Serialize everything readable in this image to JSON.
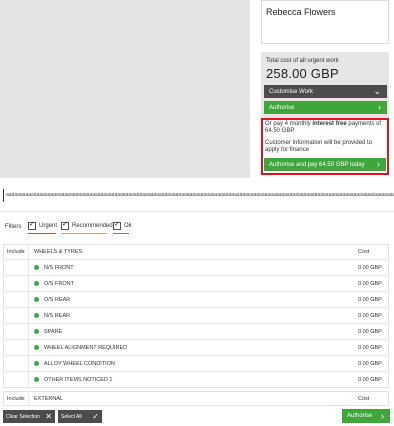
{
  "customer": {
    "name": "Rebecca Flowers"
  },
  "cost": {
    "label": "Total cost of all urgent work",
    "value": "258.00 GBP",
    "customise_label": "Customise Work",
    "authorise_label": "Authorise"
  },
  "finance": {
    "prefix": "Or pay 4 monthly ",
    "bold": "interest free",
    "suffix": " payments of 64.50 GBP",
    "info": "Customer information will be provided to apply for finance",
    "button_label": "Authorise and pay 64.50 GBP today"
  },
  "notes_value": "aaaaaaaaaaaaaaaaaaaaaaaaaaaaaaaaaaaaaaaaaaaaaaaaaaaaaaaaaaaaaaaaaaaaaaaaaaaaaaaaaaaaaaaaaaaaaaaaaaaaaaaaaaaaaaaaaaaaaaaaaaaaaaaaaaaaaaaaaaaaaaaaaaaaaaaaaaaaaaaaaaaaaaaaaaaaaaaaaaaaaaaa",
  "filters": {
    "label": "Filters",
    "urgent": "Urgent",
    "recommended": "Recommended",
    "ok": "Ok"
  },
  "table": {
    "include_header": "Include",
    "section": "WHEELS & TYRES",
    "cost_header": "Cost",
    "items": [
      {
        "name": "N/S FRONT",
        "cost": "0.00 GBP"
      },
      {
        "name": "O/S FRONT",
        "cost": "0.00 GBP"
      },
      {
        "name": "O/S REAR",
        "cost": "0.00 GBP"
      },
      {
        "name": "N/S REAR",
        "cost": "0.00 GBP"
      },
      {
        "name": "SPARE",
        "cost": "0.00 GBP"
      },
      {
        "name": "WHEEL ALIGNMENT REQUIRED",
        "cost": "0.00 GBP"
      },
      {
        "name": "ALLOY WHEEL CONDITION",
        "cost": "0.00 GBP"
      },
      {
        "name": "OTHER ITEMS NOTICED 1",
        "cost": "0.00 GBP"
      }
    ]
  },
  "table2": {
    "include_header": "Include",
    "section": "EXTERNAL",
    "cost_header": "Cost"
  },
  "bottom": {
    "clear_label": "Clear Selection",
    "select_all_label": "Select All",
    "authorise_label": "Authorise"
  },
  "colors": {
    "green": "#3ea63a",
    "dark": "#4c4c4c",
    "highlight_red": "#e0141e"
  }
}
